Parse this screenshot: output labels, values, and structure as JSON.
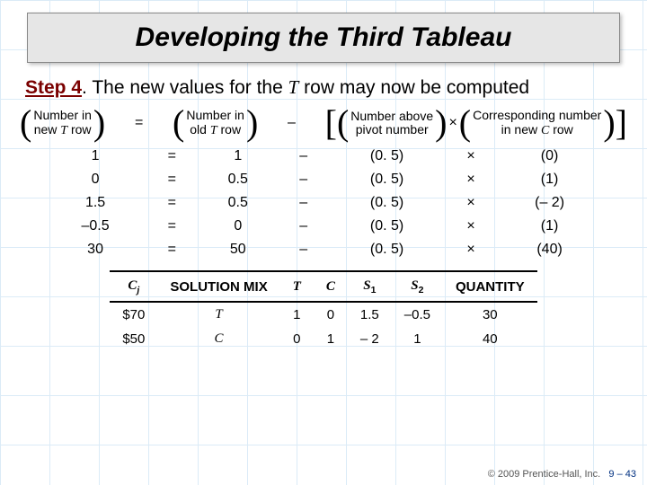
{
  "title": "Developing the Third Tableau",
  "step": {
    "label": "Step 4",
    "dot": ".",
    "text_a": " The new values for the ",
    "t_var": "T",
    "text_b": " row may now be computed"
  },
  "formula": {
    "g1_l1": "Number in",
    "g1_l2_a": "new ",
    "g1_l2_var": "T",
    "g1_l2_b": " row",
    "eq": "=",
    "g2_l1": "Number in",
    "g2_l2_a": "old ",
    "g2_l2_var": "T",
    "g2_l2_b": " row",
    "minus": "–",
    "g3_l1": "Number above",
    "g3_l2": "pivot number",
    "times_op": "×",
    "g4_l1": "Corresponding number",
    "g4_l2_a": "in new ",
    "g4_l2_var": "C",
    "g4_l2_b": " row"
  },
  "calc": [
    {
      "new": "1",
      "old": "1",
      "above": "(0. 5)",
      "corr": "(0)"
    },
    {
      "new": "0",
      "old": "0.5",
      "above": "(0. 5)",
      "corr": "(1)"
    },
    {
      "new": "1.5",
      "old": "0.5",
      "above": "(0. 5)",
      "corr": "(– 2)"
    },
    {
      "new": "–0.5",
      "old": "0",
      "above": "(0. 5)",
      "corr": "(1)"
    },
    {
      "new": "30",
      "old": "50",
      "above": "(0. 5)",
      "corr": "(40)"
    }
  ],
  "ops": {
    "eq": "=",
    "minus": "–",
    "times_op": "×"
  },
  "mix": {
    "headers": {
      "cj": "C",
      "cj_sub": "j",
      "sm": "SOLUTION MIX",
      "t": "T",
      "c": "C",
      "s1": "S",
      "s1_sub": "1",
      "s2": "S",
      "s2_sub": "2",
      "qty": "QUANTITY"
    },
    "rows": [
      {
        "cj": "$70",
        "sm": "T",
        "t": "1",
        "c": "0",
        "s1": "1.5",
        "s2": "–0.5",
        "qty": "30"
      },
      {
        "cj": "$50",
        "sm": "C",
        "t": "0",
        "c": "1",
        "s1": "– 2",
        "s2": "1",
        "qty": "40"
      }
    ]
  },
  "footer": {
    "copy": "© 2009 Prentice-Hall, Inc.",
    "page": "9 – 43"
  }
}
